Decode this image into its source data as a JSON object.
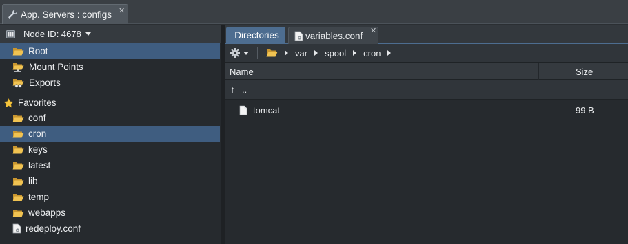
{
  "window_tab": {
    "title": "App. Servers : configs",
    "close": "✕"
  },
  "left_panel": {
    "node_label": "Node ID: 4678",
    "tree": [
      {
        "label": "Root",
        "icon": "folder-open-icon",
        "selected": true,
        "indent": 1
      },
      {
        "label": "Mount Points",
        "icon": "mount-folder-icon",
        "selected": false,
        "indent": 1
      },
      {
        "label": "Exports",
        "icon": "export-folder-icon",
        "selected": false,
        "indent": 1
      },
      {
        "label": "Favorites",
        "icon": "star-icon",
        "selected": false,
        "indent": 0
      },
      {
        "label": "conf",
        "icon": "folder-icon",
        "selected": false,
        "indent": 1
      },
      {
        "label": "cron",
        "icon": "folder-icon",
        "selected": true,
        "indent": 1
      },
      {
        "label": "keys",
        "icon": "folder-icon",
        "selected": false,
        "indent": 1
      },
      {
        "label": "latest",
        "icon": "folder-icon",
        "selected": false,
        "indent": 1
      },
      {
        "label": "lib",
        "icon": "folder-icon",
        "selected": false,
        "indent": 1
      },
      {
        "label": "temp",
        "icon": "folder-icon",
        "selected": false,
        "indent": 1
      },
      {
        "label": "webapps",
        "icon": "folder-icon",
        "selected": false,
        "indent": 1
      },
      {
        "label": "redeploy.conf",
        "icon": "config-file-icon",
        "selected": false,
        "indent": 1
      }
    ]
  },
  "right_panel": {
    "tabs": [
      {
        "label": "Directories",
        "active": true
      },
      {
        "label": "variables.conf",
        "active": false,
        "close": "✕"
      }
    ],
    "path": [
      "var",
      "spool",
      "cron"
    ],
    "columns": {
      "name": "Name",
      "size": "Size"
    },
    "parent_row": {
      "arrow": "↑",
      "label": ".."
    },
    "files": [
      {
        "name": "tomcat",
        "size": "99 B",
        "icon": "file-icon"
      }
    ]
  },
  "colors": {
    "accent": "#4d6d90",
    "selection": "#3f5d80",
    "folder": "#e8b84a",
    "background": "#262a2e"
  }
}
